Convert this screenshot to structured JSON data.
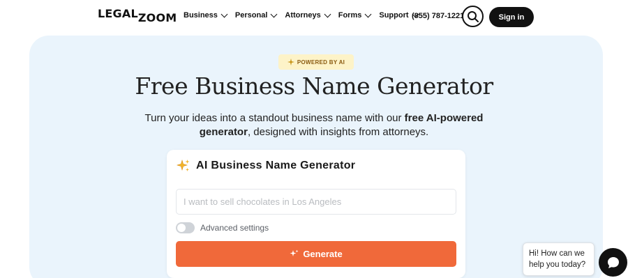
{
  "header": {
    "logo_part1": "LEGAL",
    "logo_part2": "ZOOM",
    "nav": [
      {
        "label": "Business",
        "icon": "chevron-down-icon"
      },
      {
        "label": "Personal",
        "icon": "chevron-down-icon"
      },
      {
        "label": "Attorneys",
        "icon": "chevron-down-icon"
      },
      {
        "label": "Forms",
        "icon": "chevron-down-icon"
      },
      {
        "label": "Support",
        "icon": "chevron-down-icon"
      }
    ],
    "phone": "(855) 787-1221",
    "search_icon": "search-icon",
    "signin_label": "Sign in"
  },
  "hero": {
    "badge": "POWERED BY AI",
    "badge_icon": "sparkle-icon",
    "title": "Free Business Name Generator",
    "subtitle_part1": "Turn your ideas into a standout business name with our ",
    "subtitle_bold": "free AI-powered generator",
    "subtitle_part2": ", designed with insights from attorneys."
  },
  "generator": {
    "title": "AI Business Name Generator",
    "title_icon": "sparkles-icon",
    "input_value": "",
    "input_placeholder": "I want to sell chocolates in Los Angeles",
    "advanced_label": "Advanced settings",
    "advanced_enabled": false,
    "generate_label": "Generate",
    "generate_icon": "sparkle-icon"
  },
  "chat": {
    "message": "Hi! How can we help you today?",
    "icon": "chat-icon"
  },
  "colors": {
    "brand_dark": "#111111",
    "accent_orange": "#f0693a",
    "hero_bg": "#eaf4fc",
    "badge_bg": "#fdf3c8"
  }
}
